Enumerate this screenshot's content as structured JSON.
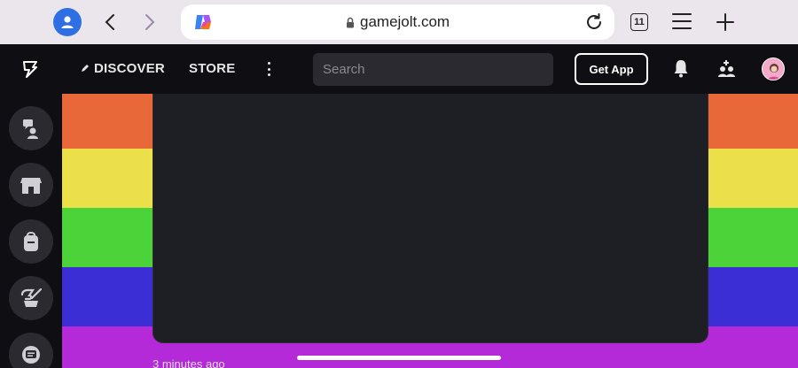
{
  "browser": {
    "url": "gamejolt.com",
    "tab_count": "11"
  },
  "header": {
    "nav": {
      "discover": "DISCOVER",
      "store": "STORE"
    },
    "search_placeholder": "Search",
    "get_app": "Get App"
  },
  "sidebar": {
    "items": [
      {
        "icon": "realms-icon"
      },
      {
        "icon": "shop-icon"
      },
      {
        "icon": "backpack-icon"
      },
      {
        "icon": "quests-icon"
      },
      {
        "icon": "chat-icon"
      }
    ]
  },
  "main": {
    "timestamp": "3 minutes ago"
  },
  "colors": {
    "stripes": [
      "#e8683a",
      "#ebe04a",
      "#4bd339",
      "#3b2ed4",
      "#b42ad8"
    ],
    "header_bg": "#0f0f13",
    "card_bg": "#1e1f25"
  }
}
